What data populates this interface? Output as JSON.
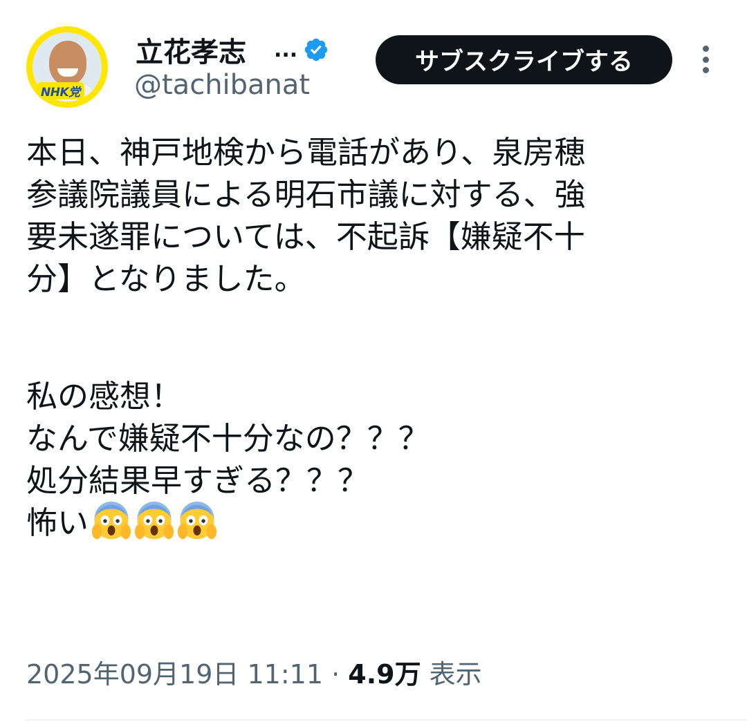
{
  "author": {
    "display_name": "立花孝志",
    "ellipsis": "...",
    "handle": "@tachibanat",
    "avatar_badge": "NHK党",
    "verified_icon": "verified-badge-icon",
    "verified_color": "#1d9bf0"
  },
  "subscribe_label": "サブスクライブする",
  "more_icon": "more-vertical-icon",
  "post": {
    "paragraph1": [
      "本日、神戸地検から電話があり、泉房穂",
      "参議院議員による明石市議に対する、強",
      "要未遂罪については、不起訴【嫌疑不十",
      "分】となりました。"
    ],
    "paragraph2": [
      "私の感想！",
      "なんで嫌疑不十分なの？？？",
      "処分結果早すぎる？？？"
    ],
    "last_line_text": "怖い",
    "last_line_emoji": "face-screaming-in-fear-emoji"
  },
  "meta": {
    "timestamp": "2025年09月19日 11:11",
    "separator": " · ",
    "views_count": "4.9万",
    "views_label": " 表示"
  },
  "colors": {
    "text_primary": "#0f1419",
    "text_secondary": "#536471",
    "button_bg": "#0f1419",
    "avatar_ring": "#ffe600"
  }
}
